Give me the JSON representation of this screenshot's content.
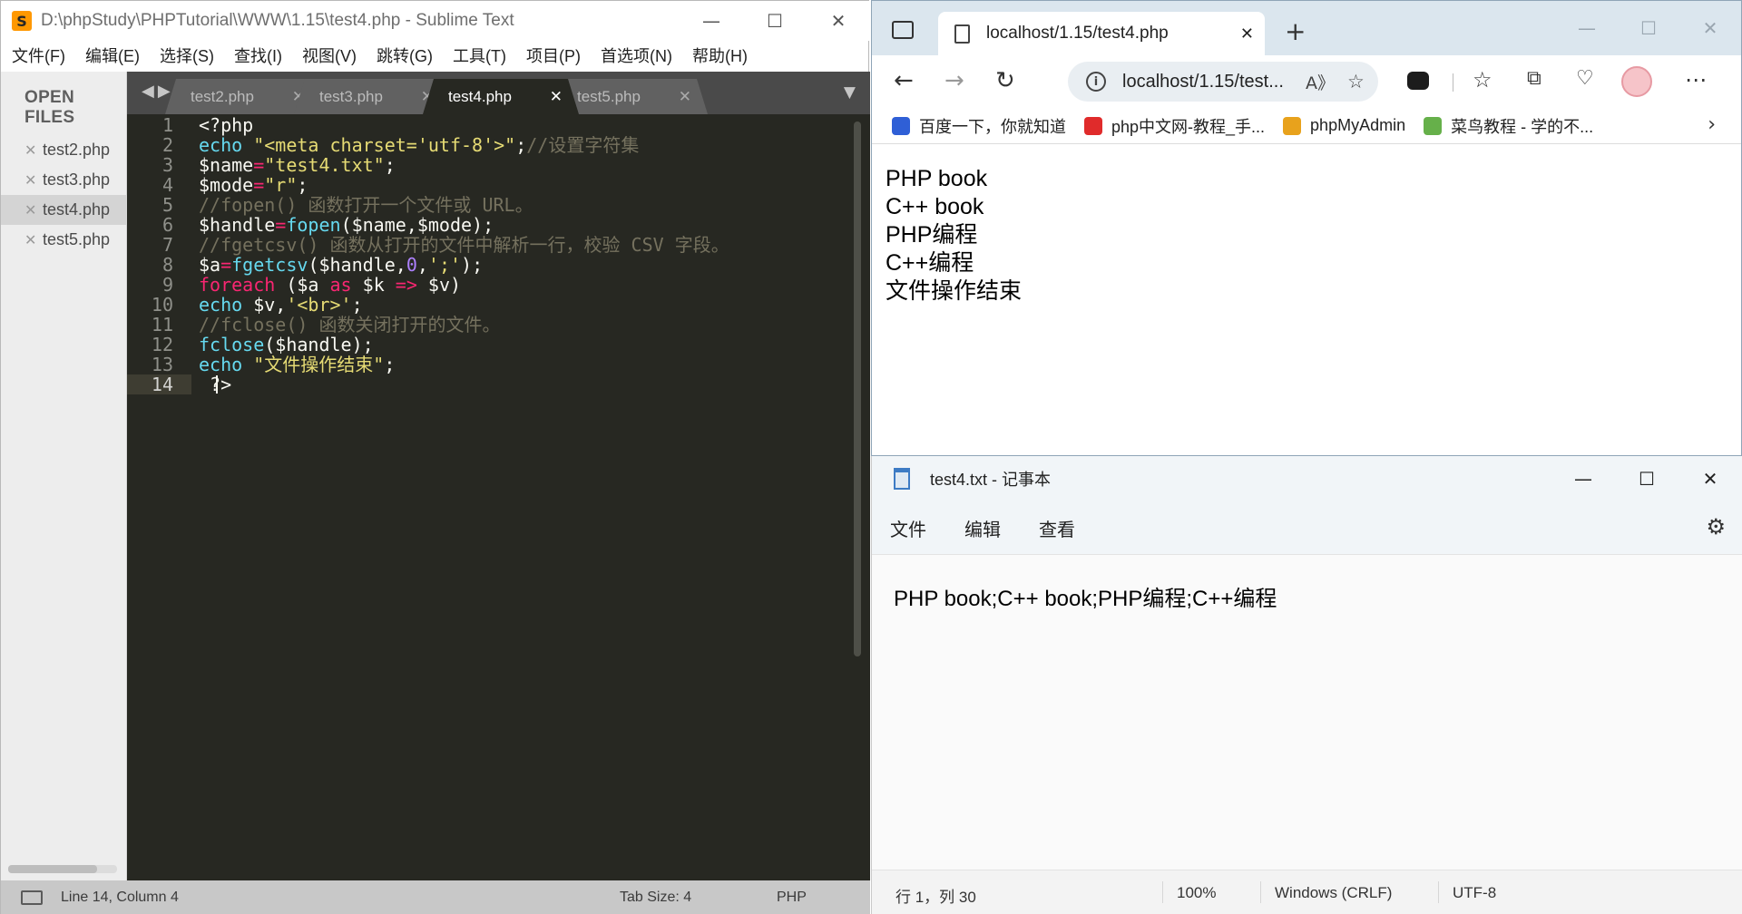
{
  "sublime": {
    "title": "D:\\phpStudy\\PHPTutorial\\WWW\\1.15\\test4.php - Sublime Text",
    "app_icon_glyph": "S",
    "menu": [
      "文件(F)",
      "编辑(E)",
      "选择(S)",
      "查找(I)",
      "视图(V)",
      "跳转(G)",
      "工具(T)",
      "项目(P)",
      "首选项(N)",
      "帮助(H)"
    ],
    "sidebar_header": "OPEN FILES",
    "open_files": [
      "test2.php",
      "test3.php",
      "test4.php",
      "test5.php"
    ],
    "active_file": "test4.php",
    "tabs": [
      "test2.php",
      "test3.php",
      "test4.php",
      "test5.php"
    ],
    "line_numbers": [
      "1",
      "2",
      "3",
      "4",
      "5",
      "6",
      "7",
      "8",
      "9",
      "10",
      "11",
      "12",
      "13",
      "14"
    ],
    "current_line": "14",
    "code": [
      [
        [
          "pl",
          "<?php"
        ]
      ],
      [
        [
          "kw",
          "echo"
        ],
        [
          "pl",
          " "
        ],
        [
          "str",
          "\"<meta charset='utf-8'>\""
        ],
        [
          "pl",
          ";"
        ],
        [
          "cmt",
          "//设置字符集"
        ]
      ],
      [
        [
          "pl",
          "$name"
        ],
        [
          "op",
          "="
        ],
        [
          "str",
          "\"test4.txt\""
        ],
        [
          "pl",
          ";"
        ]
      ],
      [
        [
          "pl",
          "$mode"
        ],
        [
          "op",
          "="
        ],
        [
          "str",
          "\"r\""
        ],
        [
          "pl",
          ";"
        ]
      ],
      [
        [
          "cmt",
          "//fopen() 函数打开一个文件或 URL。"
        ]
      ],
      [
        [
          "pl",
          "$handle"
        ],
        [
          "op",
          "="
        ],
        [
          "kw",
          "fopen"
        ],
        [
          "pl",
          "($name,$mode);"
        ]
      ],
      [
        [
          "cmt",
          "//fgetcsv() 函数从打开的文件中解析一行，校验 CSV 字段。"
        ]
      ],
      [
        [
          "pl",
          "$a"
        ],
        [
          "op",
          "="
        ],
        [
          "kw",
          "fgetcsv"
        ],
        [
          "pl",
          "($handle,"
        ],
        [
          "num",
          "0"
        ],
        [
          "pl",
          ","
        ],
        [
          "str",
          "';'"
        ],
        [
          "pl",
          ");"
        ]
      ],
      [
        [
          "op",
          "foreach"
        ],
        [
          "pl",
          " ($a "
        ],
        [
          "op",
          "as"
        ],
        [
          "pl",
          " $k "
        ],
        [
          "op",
          "=>"
        ],
        [
          "pl",
          " $v)"
        ]
      ],
      [
        [
          "kw",
          "echo"
        ],
        [
          "pl",
          " $v,"
        ],
        [
          "str",
          "'<br>'"
        ],
        [
          "pl",
          ";"
        ]
      ],
      [
        [
          "cmt",
          "//fclose() 函数关闭打开的文件。"
        ]
      ],
      [
        [
          "kw",
          "fclose"
        ],
        [
          "pl",
          "($handle);"
        ]
      ],
      [
        [
          "kw",
          "echo"
        ],
        [
          "pl",
          " "
        ],
        [
          "str",
          "\"文件操作结束\""
        ],
        [
          "pl",
          ";"
        ]
      ],
      [
        [
          "pl",
          " ?>"
        ]
      ]
    ],
    "status": {
      "position": "Line 14, Column 4",
      "tab_size": "Tab Size: 4",
      "syntax": "PHP"
    },
    "colors": {
      "editor_bg": "#272822",
      "keyword": "#66d9ef",
      "string": "#e6db74",
      "comment": "#75715e",
      "operator": "#f92672",
      "number": "#ae81ff"
    }
  },
  "browser": {
    "tab_title": "localhost/1.15/test4.php",
    "url": "localhost/1.15/test...",
    "favorites": [
      {
        "label": "百度一下，你就知道",
        "color": "#2f5fd6"
      },
      {
        "label": "php中文网-教程_手...",
        "color": "#e02b2b"
      },
      {
        "label": "phpMyAdmin",
        "color": "#e8a21c"
      },
      {
        "label": "菜鸟教程 - 学的不...",
        "color": "#66b04a"
      }
    ],
    "page_lines": [
      "PHP book",
      "C++ book",
      "PHP编程",
      "C++编程",
      "文件操作结束"
    ]
  },
  "notepad": {
    "title": "test4.txt - 记事本",
    "menu": [
      "文件",
      "编辑",
      "查看"
    ],
    "content": "PHP book;C++ book;PHP编程;C++编程",
    "status": {
      "position": "行 1，列 30",
      "zoom": "100%",
      "line_ending": "Windows (CRLF)",
      "encoding": "UTF-8"
    }
  }
}
